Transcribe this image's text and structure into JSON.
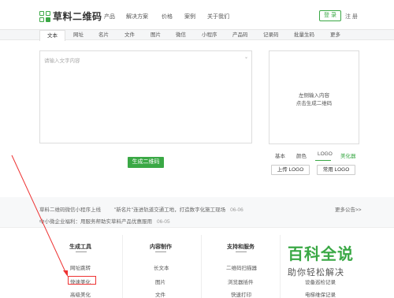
{
  "header": {
    "logo_text": "草料二维码",
    "nav": [
      "产品",
      "解决方案",
      "价格",
      "案例",
      "关于我们"
    ],
    "login_label": "登 录",
    "register_label": "注 册"
  },
  "tabs": [
    "文本",
    "网址",
    "名片",
    "文件",
    "图片",
    "微信",
    "小程序",
    "产品码",
    "记录码",
    "批量生码",
    "更多"
  ],
  "editor": {
    "placeholder": "请输入文字内容",
    "generate_label": "生成二维码"
  },
  "preview": {
    "line1": "左侧输入内容",
    "line2": "点击生成二维码"
  },
  "style_tabs": [
    "基本",
    "颜色",
    "LOGO",
    "美化器"
  ],
  "logo_buttons": [
    "上传 LOGO",
    "常用 LOGO"
  ],
  "news": [
    {
      "text": "草料二维码微信小程序上线",
      "date": ""
    },
    {
      "text": "\"新名片\"连进轨道交通工地，打造数字化施工现场",
      "date": "06-06"
    },
    {
      "text": "中小微企业福利：用服务帮助实草料产品优惠服用",
      "date": "06-05"
    }
  ],
  "news_more": "更多公告>>",
  "footer": {
    "columns": [
      {
        "title": "生成工具",
        "links": [
          "网址跳转",
          "快速美化",
          "高级美化"
        ]
      },
      {
        "title": "内容制作",
        "links": [
          "长文本",
          "图片",
          "文件"
        ]
      },
      {
        "title": "支持和服务",
        "links": [
          "二维码扫描器",
          "浏览器插件",
          "快速打印"
        ]
      },
      {
        "title": "",
        "links": [
          "",
          "设备巡检记录",
          "电梯维保记录"
        ]
      }
    ]
  },
  "watermark": {
    "line1": "百科全说",
    "line2": "助你轻松解决"
  },
  "colors": {
    "accent": "#3aa845",
    "highlight": "#e33333"
  }
}
